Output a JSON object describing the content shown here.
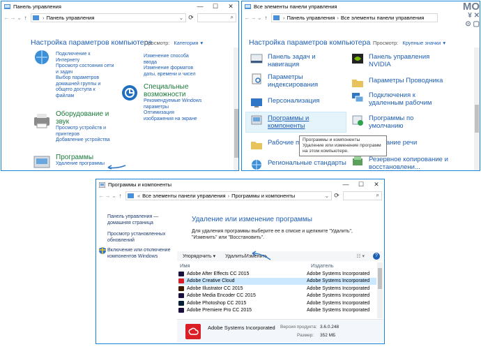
{
  "win1": {
    "title": "Панель управления",
    "address": "Панель управления",
    "heading": "Настройка параметров компьютера",
    "view_label": "Просмотр:",
    "view_value": "Категория",
    "net_links": [
      "Подключение к",
      "Интернету",
      "Просмотр состояния сети",
      "и задач",
      "Выбор параметров",
      "домашней группы и",
      "общего доступа к",
      "файлам"
    ],
    "hw": {
      "title_1": "Оборудование и",
      "title_2": "звук",
      "links": [
        "Просмотр устройств и",
        "принтеров",
        "Добавление устройства"
      ]
    },
    "progs": {
      "title": "Программы",
      "link": "Удаление программы"
    },
    "right_links": [
      "Изменение способа",
      "ввода",
      "Изменение форматов",
      "даты, времени и чисел"
    ],
    "access": {
      "title_1": "Специальные",
      "title_2": "возможности",
      "links": [
        "Рекомендуемые Windows",
        "параметры",
        "Оптимизация",
        "изображения на экране"
      ]
    }
  },
  "win2": {
    "title": "Все элементы панели управления",
    "address_1": "Панель управления",
    "address_2": "Все элементы панели управления",
    "heading": "Настройка параметров компьютера",
    "view_label": "Просмотр:",
    "view_value": "Крупные значки",
    "left": [
      {
        "l1": "Панель задач и",
        "l2": "навигация"
      },
      {
        "l1": "Параметры",
        "l2": "индексирования"
      },
      {
        "l1": "Персонализация",
        "l2": ""
      },
      {
        "l1": "Программы и",
        "l2": "компоненты"
      },
      {
        "l1": "Рабочие п",
        "l2": ""
      },
      {
        "l1": "Региональные стандарты",
        "l2": ""
      }
    ],
    "right": [
      {
        "l1": "Панель управления",
        "l2": "NVIDIA"
      },
      {
        "l1": "Параметры Проводника",
        "l2": ""
      },
      {
        "l1": "Подключения к",
        "l2": "удаленным рабочим"
      },
      {
        "l1": "Программы по",
        "l2": "умолчанию"
      },
      {
        "l1": "ознавание речи",
        "l2": ""
      },
      {
        "l1": "Резервное копирование и",
        "l2": "восстановлени..."
      }
    ],
    "tooltip": [
      "Программы и компоненты",
      "Удаление или изменение программ",
      "на этом компьютере."
    ]
  },
  "win3": {
    "title": "Программы и компоненты",
    "address_1": "Все элементы панели управления",
    "address_2": "Программы и компоненты",
    "left_links": [
      "Панель управления —",
      "домашняя страница",
      "Просмотр установленных",
      "обновлений",
      "Включение или отключение",
      "компонентов Windows"
    ],
    "heading": "Удаление или изменение программы",
    "desc_1": "Для удаления программы выберите ее в списке и щелкните \"Удалить\",",
    "desc_2": "\"Изменить\" или \"Восстановить\".",
    "organize": "Упорядочить",
    "uninstall": "Удалить/Изменить",
    "col_name": "Имя",
    "col_publisher": "Издатель",
    "programs": [
      {
        "name": "Adobe After Effects CC 2015",
        "publisher": "Adobe Systems Incorporated",
        "color": "#1a0f3d"
      },
      {
        "name": "Adobe Creative Cloud",
        "publisher": "Adobe Systems Incorporated",
        "color": "#da1f26"
      },
      {
        "name": "Adobe Illustrator CC 2015",
        "publisher": "Adobe Systems Incorporated",
        "color": "#3d1a00"
      },
      {
        "name": "Adobe Media Encoder CC 2015",
        "publisher": "Adobe Systems Incorporated",
        "color": "#1a0f3d"
      },
      {
        "name": "Adobe Photoshop CC 2015",
        "publisher": "Adobe Systems Incorporated",
        "color": "#001d34"
      },
      {
        "name": "Adobe Premiere Pro CC 2015",
        "publisher": "Adobe Systems Incorporated",
        "color": "#1a0f3d"
      }
    ],
    "detail": {
      "publisher": "Adobe Systems Incorporated",
      "version_label": "Версия продукта:",
      "version": "3.6.0.248",
      "size_label": "Размер:",
      "size": "352 МБ"
    }
  },
  "watermark": {
    "m": "M",
    "o": "O"
  },
  "colors": {
    "accent": "#1883d7",
    "link": "#1e5eb4",
    "selection": "#cce8ff"
  }
}
